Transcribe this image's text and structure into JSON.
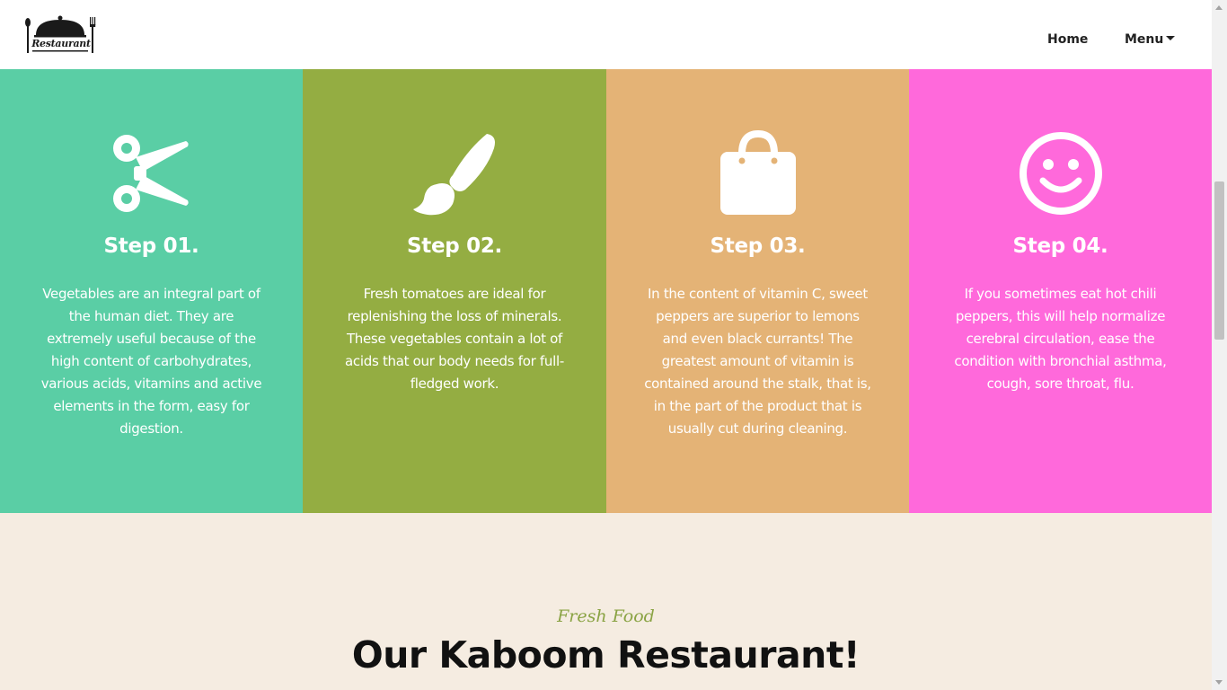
{
  "header": {
    "logo_text": "Restaurant",
    "nav": {
      "home": "Home",
      "menu": "Menu"
    }
  },
  "steps": [
    {
      "icon": "scissors-icon",
      "color": "#5acea5",
      "title": "Step 01.",
      "text": "Vegetables are an integral part of the human diet. They are extremely useful because of the high content of carbohydrates, various acids, vitamins and active elements in the form, easy for digestion."
    },
    {
      "icon": "paint-brush-icon",
      "color": "#94ad42",
      "title": "Step 02.",
      "text": "Fresh tomatoes are ideal for replenishing the loss of minerals. These vegetables contain a lot of acids that our body needs for full-fledged work."
    },
    {
      "icon": "shopping-bag-icon",
      "color": "#e4b376",
      "title": "Step 03.",
      "text": "In the content of vitamin C, sweet peppers are superior to lemons and even black currants! The greatest amount of vitamin is contained around the stalk, that is, in the part of the product that is usually cut during cleaning."
    },
    {
      "icon": "smiley-face-icon",
      "color": "#ff69db",
      "title": "Step 04.",
      "text": "If you sometimes eat hot chili peppers, this will help normalize cerebral circulation, ease the condition with bronchial asthma, cough, sore throat, flu."
    }
  ],
  "intro": {
    "kicker": "Fresh Food",
    "title": "Our Kaboom Restaurant!"
  },
  "colors": {
    "intro_background": "#f5ece1",
    "kicker": "#8aa344"
  }
}
